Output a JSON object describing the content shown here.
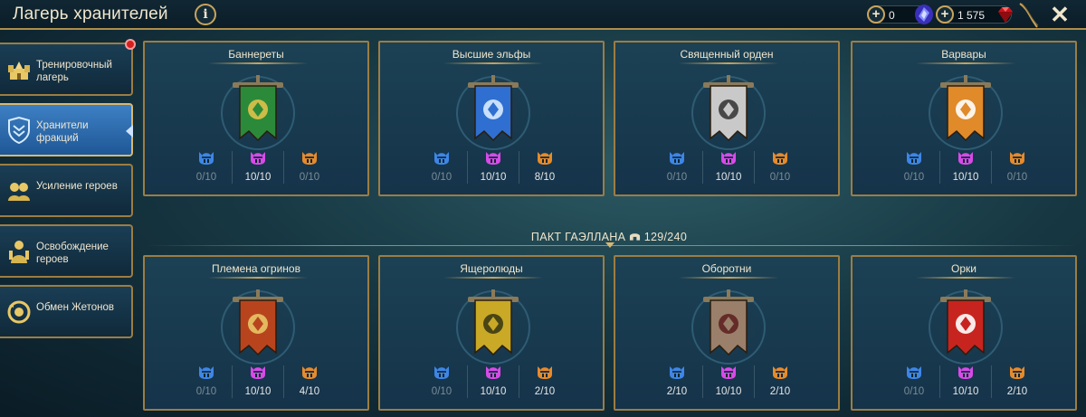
{
  "header": {
    "title": "Лагерь хранителей",
    "info_symbol": "i",
    "close_symbol": "✕",
    "gems_value": "0",
    "rubies_value": "1 575"
  },
  "sidebar": {
    "items": [
      {
        "label": "Тренировочный лагерь",
        "icon": "training-camp-icon"
      },
      {
        "label": "Хранители фракций",
        "icon": "faction-guardians-icon"
      },
      {
        "label": "Усиление героев",
        "icon": "hero-empower-icon"
      },
      {
        "label": "Освобождение героев",
        "icon": "hero-release-icon"
      },
      {
        "label": "Обмен Жетонов",
        "icon": "token-exchange-icon"
      }
    ]
  },
  "pact": {
    "label": "ПАКТ ГАЭЛЛАНА",
    "value": "129/240"
  },
  "colors": {
    "rare": "#3d86e6",
    "epic": "#d84ae8",
    "legendary": "#e78a2a",
    "gold": "#c9a45c"
  },
  "factions": [
    {
      "name": "Баннереты",
      "counts": [
        "0/10",
        "10/10",
        "0/10"
      ]
    },
    {
      "name": "Высшие эльфы",
      "counts": [
        "0/10",
        "10/10",
        "8/10"
      ]
    },
    {
      "name": "Священный орден",
      "counts": [
        "0/10",
        "10/10",
        "0/10"
      ]
    },
    {
      "name": "Варвары",
      "counts": [
        "0/10",
        "10/10",
        "0/10"
      ]
    },
    {
      "name": "Племена огринов",
      "counts": [
        "0/10",
        "10/10",
        "4/10"
      ]
    },
    {
      "name": "Ящеролюды",
      "counts": [
        "0/10",
        "10/10",
        "2/10"
      ]
    },
    {
      "name": "Оборотни",
      "counts": [
        "2/10",
        "10/10",
        "2/10"
      ]
    },
    {
      "name": "Орки",
      "counts": [
        "0/10",
        "10/10",
        "2/10"
      ]
    }
  ]
}
